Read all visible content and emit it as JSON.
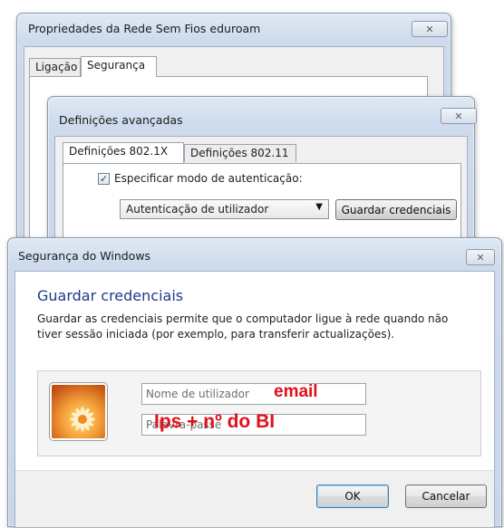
{
  "window_wifi": {
    "title": "Propriedades da Rede Sem Fios eduroam",
    "tabs": [
      "Ligação",
      "Segurança"
    ],
    "active_tab": "Segurança",
    "close_glyph": "✕"
  },
  "window_advanced": {
    "title": "Definições avançadas",
    "tabs": [
      "Definições 802.1X",
      "Definições 802.11"
    ],
    "active_tab": "Definições 802.1X",
    "checkbox_label": "Especificar modo de autenticação:",
    "checkbox_checked": true,
    "checkbox_glyph": "✓",
    "auth_mode_value": "Autenticação de utilizador",
    "dropdown_glyph": "▼",
    "save_credentials_button": "Guardar credenciais",
    "close_glyph": "✕"
  },
  "window_security": {
    "title": "Segurança do Windows",
    "close_glyph": "✕",
    "heading": "Guardar credenciais",
    "description": "Guardar as credenciais permite que o computador ligue à rede quando não tiver sessão iniciada (por exemplo, para transferir actualizações).",
    "username_placeholder": "Nome de utilizador",
    "password_placeholder": "Palavra-passe",
    "ok_button": "OK",
    "cancel_button": "Cancelar"
  },
  "annotations": {
    "username_hint": "email",
    "password_hint": "Ips + nº do BI"
  },
  "icons": {
    "avatar": "user-avatar-flower-icon",
    "close": "close-icon",
    "dropdown": "chevron-down-icon",
    "checkbox": "checkmark-icon"
  },
  "colors": {
    "annotation_red": "#e3101a",
    "heading_blue": "#1d3a8a",
    "ok_button_border": "#3c7fb1"
  }
}
